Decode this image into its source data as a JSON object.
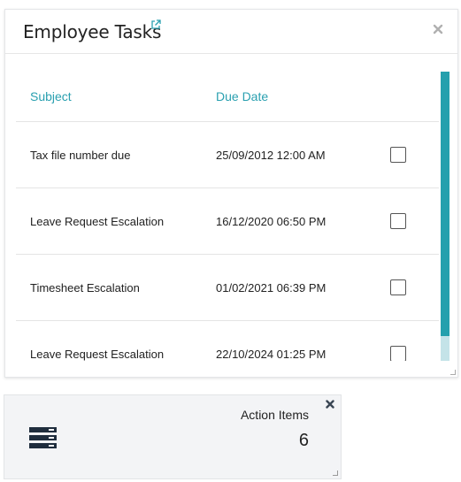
{
  "tasks_widget": {
    "title": "Employee Tasks",
    "columns": {
      "subject": "Subject",
      "due_date": "Due Date"
    },
    "rows": [
      {
        "subject": "Tax file number due",
        "due_date": "25/09/2012 12:00 AM",
        "checked": false
      },
      {
        "subject": "Leave Request Escalation",
        "due_date": "16/12/2020 06:50 PM",
        "checked": false
      },
      {
        "subject": "Timesheet Escalation",
        "due_date": "01/02/2021 06:39 PM",
        "checked": false
      },
      {
        "subject": "Leave Request Escalation",
        "due_date": "22/10/2024 01:25 PM",
        "checked": false
      }
    ],
    "accent_color": "#2aa0b0",
    "scrollbar_color": "#24a0ad"
  },
  "action_widget": {
    "label": "Action Items",
    "count": "6",
    "icon": "list-icon"
  }
}
